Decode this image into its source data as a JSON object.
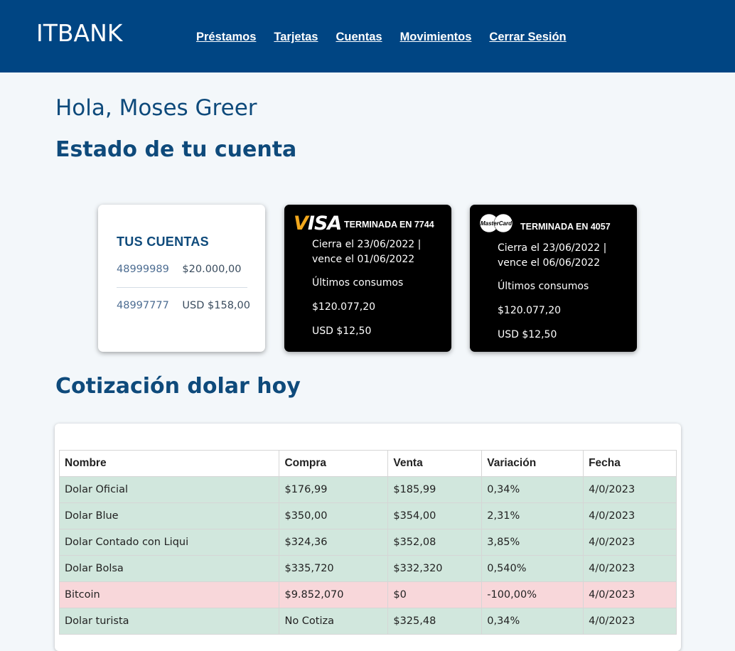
{
  "header": {
    "logo": "ITBANK",
    "nav": [
      {
        "label": "Préstamos"
      },
      {
        "label": "Tarjetas"
      },
      {
        "label": "Cuentas"
      },
      {
        "label": "Movimientos"
      },
      {
        "label": "Cerrar Sesión"
      }
    ],
    "bg_color": "#004583"
  },
  "greeting": "Hola, Moses Greer",
  "estado_heading": "Estado de tu cuenta",
  "accounts": {
    "title": "TUS CUENTAS",
    "rows": [
      {
        "number": "48999989",
        "balance": "$20.000,00"
      },
      {
        "number": "48997777",
        "balance": "USD $158,00"
      }
    ]
  },
  "cards": [
    {
      "brand": "VISA",
      "brand_icon": "visa-logo",
      "title": "TERMINADA EN 7744",
      "cierra": "Cierra el 23/06/2022 |",
      "vence": "vence el 01/06/2022",
      "ultimos": "Últimos consumos",
      "amount_ars": "$120.077,20",
      "amount_usd": "USD $12,50"
    },
    {
      "brand": "MasterCard",
      "brand_icon": "mastercard-logo",
      "title": "TERMINADA EN 4057",
      "cierra": "Cierra el 23/06/2022 |",
      "vence": "vence el 06/06/2022",
      "ultimos": "Últimos consumos",
      "amount_ars": "$120.077,20",
      "amount_usd": "USD $12,50"
    }
  ],
  "cotizacion": {
    "heading": "Cotización dolar hoy",
    "columns": [
      "Nombre",
      "Compra",
      "Venta",
      "Variación",
      "Fecha"
    ],
    "rows": [
      {
        "nombre": "Dolar Oficial",
        "compra": "$176,99",
        "venta": "$185,99",
        "variacion": "0,34%",
        "fecha": "4/0/2023",
        "status": "up"
      },
      {
        "nombre": "Dolar Blue",
        "compra": "$350,00",
        "venta": "$354,00",
        "variacion": "2,31%",
        "fecha": "4/0/2023",
        "status": "up"
      },
      {
        "nombre": "Dolar Contado con Liqui",
        "compra": "$324,36",
        "venta": "$352,08",
        "variacion": "3,85%",
        "fecha": "4/0/2023",
        "status": "up"
      },
      {
        "nombre": "Dolar Bolsa",
        "compra": "$335,720",
        "venta": "$332,320",
        "variacion": "0,540%",
        "fecha": "4/0/2023",
        "status": "up"
      },
      {
        "nombre": "Bitcoin",
        "compra": "$9.852,070",
        "venta": "$0",
        "variacion": "-100,00%",
        "fecha": "4/0/2023",
        "status": "down"
      },
      {
        "nombre": "Dolar turista",
        "compra": "No Cotiza",
        "venta": "$325,48",
        "variacion": "0,34%",
        "fecha": "4/0/2023",
        "status": "up"
      }
    ],
    "colors": {
      "up": "#d1e7dd",
      "down": "#f8d7da"
    }
  }
}
